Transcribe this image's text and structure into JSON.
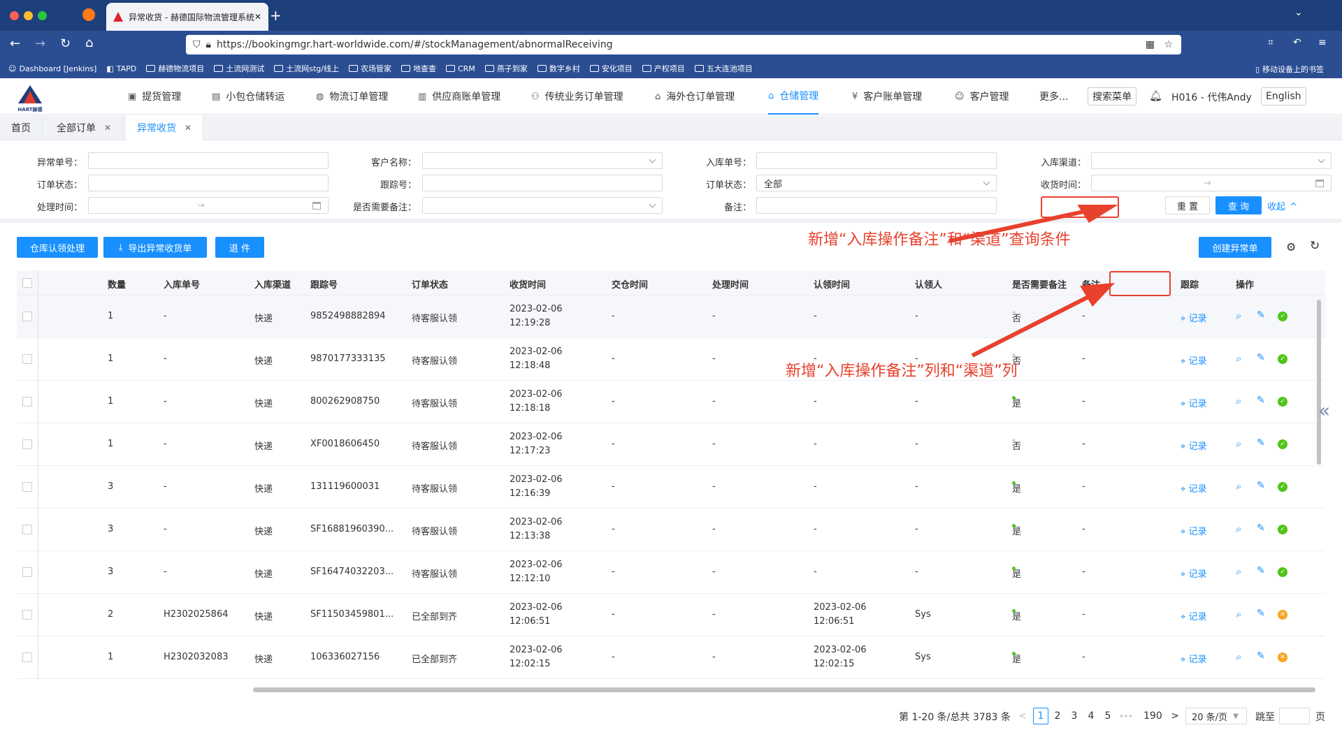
{
  "browser": {
    "tab_title": "异常收货 - 赫德国际物流管理系统",
    "url": "https://bookingmgr.hart-worldwide.com/#/stockManagement/abnormalReceiving",
    "bookmarks": [
      "Dashboard [Jenkins]",
      "TAPD",
      "赫德物流项目",
      "土流网测试",
      "土流网stg/线上",
      "农场管家",
      "地查查",
      "CRM",
      "燕子到家",
      "数字乡村",
      "安化项目",
      "产权项目",
      "五大连池项目"
    ],
    "mobile_bookmarks": "移动设备上的书签"
  },
  "header": {
    "logo_text": "HART赫德",
    "nav": [
      "提货管理",
      "小包仓储转运",
      "物流订单管理",
      "供应商账单管理",
      "传统业务订单管理",
      "海外仓订单管理",
      "仓储管理",
      "客户账单管理",
      "客户管理",
      "更多..."
    ],
    "search_menu": "搜索菜单",
    "user": "H016 - 代伟Andy",
    "language": "English"
  },
  "page_tabs": [
    "首页",
    "全部订单",
    "异常收货"
  ],
  "filters": {
    "labels": [
      "异常单号：",
      "客户名称：",
      "入库单号：",
      "入库渠道：",
      "订单状态：",
      "跟踪号：",
      "订单状态：",
      "收货时间：",
      "处理时间：",
      "是否需要备注：",
      "备注："
    ],
    "order_status_value": "全部",
    "date_sep": "→",
    "reset": "重 置",
    "search": "查 询",
    "collapse": "收起"
  },
  "toolbar": {
    "confirm": "仓库认领处理",
    "export": "导出异常收货单",
    "back": "退 件",
    "create": "创建异常单"
  },
  "annotations": {
    "filters_note": "新增“入库操作备注”和“渠道”查询条件",
    "columns_note": "新增“入库操作备注”列和“渠道”列"
  },
  "table": {
    "headers": [
      "数量",
      "入库单号",
      "入库渠道",
      "跟踪号",
      "订单状态",
      "收货时间",
      "交仓时间",
      "处理时间",
      "认领时间",
      "认领人",
      "是否需要备注",
      "备注",
      "跟踪",
      "操作"
    ],
    "record_label": "记录",
    "rows": [
      {
        "qty": "1",
        "inbound": "-",
        "channel": "快递",
        "tracking": "9852498882894",
        "status": "待客服认领",
        "recv_date": "2023-02-06",
        "recv_time": "12:19:28",
        "deliver": "-",
        "process": "-",
        "claim_date": "-",
        "claim_time": "",
        "claimer": "-",
        "need_note": "否",
        "note": "-",
        "state": "ok"
      },
      {
        "qty": "1",
        "inbound": "-",
        "channel": "快递",
        "tracking": "9870177333135",
        "status": "待客服认领",
        "recv_date": "2023-02-06",
        "recv_time": "12:18:48",
        "deliver": "-",
        "process": "-",
        "claim_date": "-",
        "claim_time": "",
        "claimer": "-",
        "need_note": "否",
        "note": "-",
        "state": "ok"
      },
      {
        "qty": "1",
        "inbound": "-",
        "channel": "快递",
        "tracking": "800262908750",
        "status": "待客服认领",
        "recv_date": "2023-02-06",
        "recv_time": "12:18:18",
        "deliver": "-",
        "process": "-",
        "claim_date": "-",
        "claim_time": "",
        "claimer": "-",
        "need_note": "是",
        "note": "-",
        "state": "ok"
      },
      {
        "qty": "1",
        "inbound": "-",
        "channel": "快递",
        "tracking": "XF0018606450",
        "status": "待客服认领",
        "recv_date": "2023-02-06",
        "recv_time": "12:17:23",
        "deliver": "-",
        "process": "-",
        "claim_date": "-",
        "claim_time": "",
        "claimer": "-",
        "need_note": "否",
        "note": "-",
        "state": "ok"
      },
      {
        "qty": "3",
        "inbound": "-",
        "channel": "快递",
        "tracking": "131119600031",
        "status": "待客服认领",
        "recv_date": "2023-02-06",
        "recv_time": "12:16:39",
        "deliver": "-",
        "process": "-",
        "claim_date": "-",
        "claim_time": "",
        "claimer": "-",
        "need_note": "是",
        "note": "-",
        "state": "ok"
      },
      {
        "qty": "3",
        "inbound": "-",
        "channel": "快递",
        "tracking": "SF16881960390...",
        "status": "待客服认领",
        "recv_date": "2023-02-06",
        "recv_time": "12:13:38",
        "deliver": "-",
        "process": "-",
        "claim_date": "-",
        "claim_time": "",
        "claimer": "-",
        "need_note": "是",
        "note": "-",
        "state": "ok"
      },
      {
        "qty": "3",
        "inbound": "-",
        "channel": "快递",
        "tracking": "SF16474032203...",
        "status": "待客服认领",
        "recv_date": "2023-02-06",
        "recv_time": "12:12:10",
        "deliver": "-",
        "process": "-",
        "claim_date": "-",
        "claim_time": "",
        "claimer": "-",
        "need_note": "是",
        "note": "-",
        "state": "ok"
      },
      {
        "qty": "2",
        "inbound": "H2302025864",
        "channel": "快递",
        "tracking": "SF11503459801...",
        "status": "已全部到齐",
        "recv_date": "2023-02-06",
        "recv_time": "12:06:51",
        "deliver": "-",
        "process": "-",
        "claim_date": "2023-02-06",
        "claim_time": "12:06:51",
        "claimer": "Sys",
        "need_note": "是",
        "note": "-",
        "state": "warn"
      },
      {
        "qty": "1",
        "inbound": "H2302032083",
        "channel": "快递",
        "tracking": "106336027156",
        "status": "已全部到齐",
        "recv_date": "2023-02-06",
        "recv_time": "12:02:15",
        "deliver": "-",
        "process": "-",
        "claim_date": "2023-02-06",
        "claim_time": "12:02:15",
        "claimer": "Sys",
        "need_note": "是",
        "note": "-",
        "state": "warn"
      }
    ]
  },
  "pagination": {
    "summary": "第 1-20 条/总共 3783 条",
    "prev": "<",
    "pages": [
      "1",
      "2",
      "3",
      "4",
      "5"
    ],
    "ellipsis": "•••",
    "last": "190",
    "next": ">",
    "page_size": "20 条/页",
    "jump_label": "跳至",
    "page_unit": "页"
  },
  "colors": {
    "primary": "#1890ff",
    "annotation": "#e8412e",
    "browser_frame": "#1d3f7b"
  }
}
